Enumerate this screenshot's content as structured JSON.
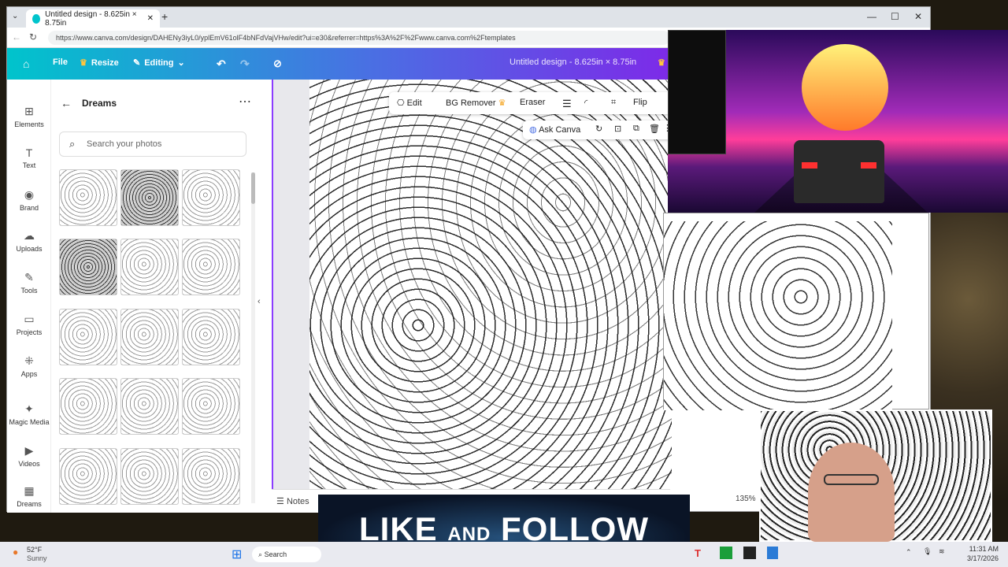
{
  "browser": {
    "tab_title": "Untitled design - 8.625in × 8.75in",
    "url": "https://www.canva.com/design/DAHENy3iyL0/yplEmV61olF4bNFdVajVHw/edit?ui=e30&referrer=https%3A%2F%2Fwww.canva.com%2Ftemplates",
    "new_tab": "+",
    "minimize": "—",
    "maximize": "☐",
    "close": "✕"
  },
  "header": {
    "file": "File",
    "resize": "Resize",
    "editing": "Editing",
    "doc_title": "Untitled design - 8.625in × 8.75in"
  },
  "rail": [
    {
      "label": "Elements",
      "icon": "⊞"
    },
    {
      "label": "Text",
      "icon": "T"
    },
    {
      "label": "Brand",
      "icon": "◉"
    },
    {
      "label": "Uploads",
      "icon": "☁"
    },
    {
      "label": "Tools",
      "icon": "✎"
    },
    {
      "label": "Projects",
      "icon": "▭"
    },
    {
      "label": "Apps",
      "icon": "⁜"
    },
    {
      "label": "Magic Media",
      "icon": "✦"
    },
    {
      "label": "Videos",
      "icon": "▶"
    },
    {
      "label": "Dreams",
      "icon": "▦"
    }
  ],
  "panel": {
    "title": "Dreams",
    "search_placeholder": "Search your photos"
  },
  "toolbar": {
    "edit": "Edit",
    "bg_remover": "BG Remover",
    "eraser": "Eraser",
    "flip": "Flip",
    "ask_canva": "Ask Canva"
  },
  "bottom": {
    "notes": "Notes",
    "zoom": "135%"
  },
  "banner": {
    "like": "LIKE",
    "and": "AND",
    "follow": "FOLLOW"
  },
  "taskbar": {
    "weather_temp": "52°F",
    "weather_desc": "Sunny",
    "search": "Search",
    "time": "11:31 AM",
    "date": "3/17/2026"
  },
  "colors": {
    "header_start": "#00c4cc",
    "header_end": "#7d2ae8",
    "selection": "#8b3dff"
  }
}
